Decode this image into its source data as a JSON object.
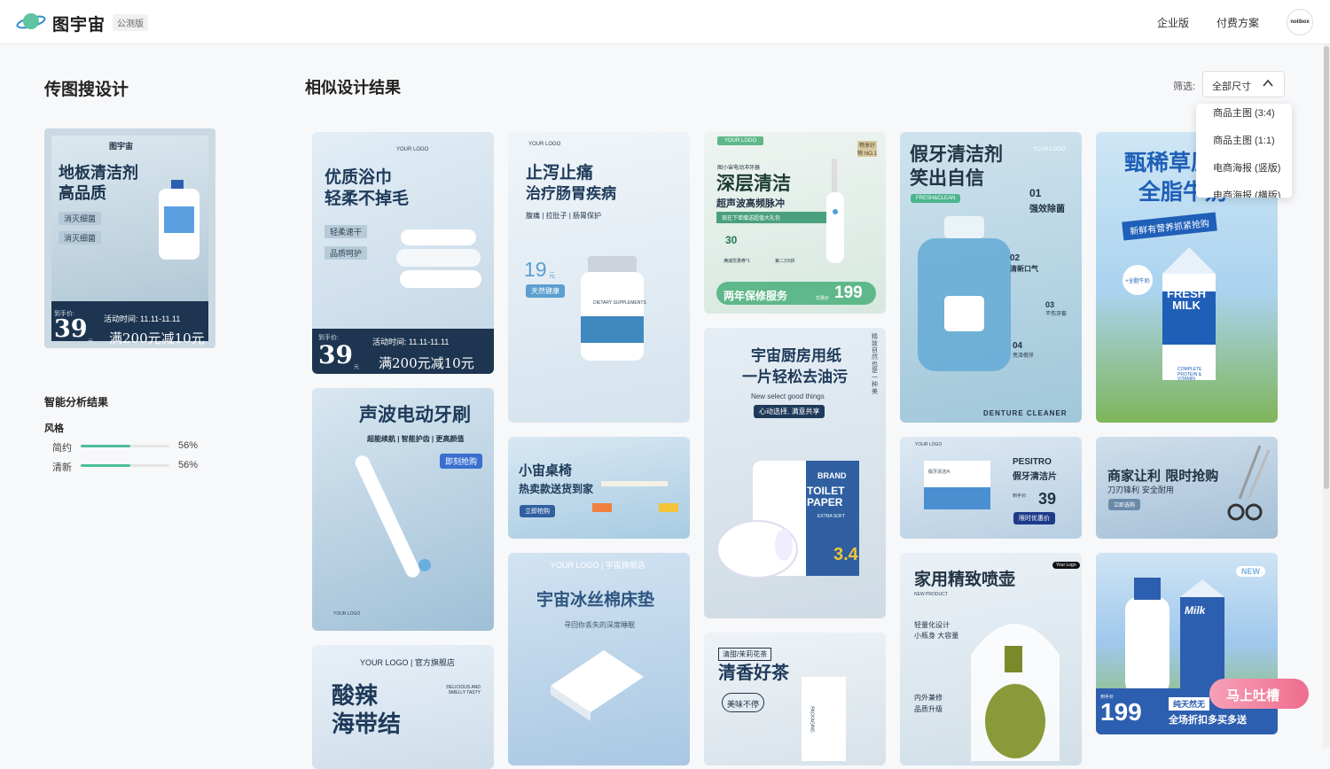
{
  "nav": {
    "brand": "图宇宙",
    "beta_badge": "公测版",
    "enterprise": "企业版",
    "pricing": "付费方案",
    "avatar": "nolibox"
  },
  "left": {
    "title": "传图搜设计",
    "upload": {
      "logo": "图宇宙",
      "title_1": "地板清洁剂",
      "title_2": "高品质",
      "tag_1": "消灭细菌",
      "tag_2": "消灭细菌",
      "price_label": "到手价:",
      "price": "39",
      "unit": "元",
      "date": "活动时间: 11.11-11.11",
      "promo": "满200元减10元"
    },
    "analysis_title": "智能分析结果",
    "style_label": "风格",
    "styles": [
      {
        "name": "简约",
        "pct": "56%",
        "value": 0.56
      },
      {
        "name": "清新",
        "pct": "56%",
        "value": 0.56
      }
    ]
  },
  "results": {
    "title": "相似设计结果",
    "filter_label": "筛选:",
    "filter_value": "全部尺寸",
    "options": [
      "商品主图 (3:4)",
      "商品主图 (1:1)",
      "电商海报 (竖版)",
      "电商海报 (横版)"
    ]
  },
  "cards": {
    "bath": {
      "logo": "YOUR LOGO",
      "title_1": "优质浴巾",
      "title_2": "轻柔不掉毛",
      "tag_1": "轻柔速干",
      "tag_2": "品质呵护",
      "price_label": "到手价:",
      "price": "39",
      "unit": "元",
      "date": "活动时间: 11.11-11.11",
      "promo": "满200元减10元"
    },
    "tooth": {
      "title": "声波电动牙刷",
      "sub": "超能续航 | 智能护齿 | 更高颜值",
      "pill": "即刻抢购",
      "logo": "YOUR LOGO"
    },
    "kelp": {
      "logo": "YOUR LOGO | 官方旗舰店",
      "title_1": "酸辣",
      "title_2": "海带结",
      "sub": "DELICIOUS AND SMELLY TASTY"
    },
    "med": {
      "logo": "YOUR LOGO",
      "title_1": "止泻止痛",
      "title_2": "治疗肠胃疾病",
      "sub": "腹痛 | 拉肚子 | 肠胃保护",
      "price": "19",
      "unit": "元",
      "pill": "天然健康",
      "bottle": "DIETARY SUPPLEMENTS"
    },
    "desk": {
      "title_1": "小宙桌椅",
      "title_2": "热卖款送货到家",
      "pill": "立即抢购"
    },
    "mat": {
      "logo": "YOUR LOGO | 宇宙旗舰店",
      "title": "宇宙冰丝棉床垫",
      "sub": "寻回你丢失的深度睡眠"
    },
    "pulse": {
      "logo": "YOUR LOGO",
      "badge": "畅享好物 NO.1",
      "small": "图小宙电动冲牙器",
      "title": "深层清洁",
      "sub": "超声波高频脉冲",
      "bar": "现在下单赠送超值大礼包",
      "num": "30",
      "gift1": "满减优惠券*1",
      "gift2": "第二只5折",
      "service": "两年保修服务",
      "price_label": "优惠价",
      "price": "199"
    },
    "paper": {
      "vert": "精致自然 也是一种美",
      "title_1": "宇宙厨房用纸",
      "title_2": "一片轻松去油污",
      "sub": "New select good things",
      "pill": "心动选择, 满意共享",
      "brand": "BRAND",
      "name": "TOILET PAPER",
      "extra": "EXTRA SOFT",
      "count": "3.4"
    },
    "tea": {
      "tag": "清甜/茉莉花茶",
      "title": "清香好茶",
      "badge": "美味不停",
      "pack": "PACKAGING"
    },
    "denture": {
      "logo": "YOUR LOGO",
      "title_1": "假牙清洁剂",
      "title_2": "笑出自信",
      "pill": "FRESH&CLEAN",
      "f1": "01",
      "f1t": "强效除菌",
      "f2": "02",
      "f2t": "清新口气",
      "f3": "03",
      "f3t": "不伤牙套",
      "f4": "04",
      "f4t": "亮泽假牙",
      "foot": "DENTURE CLEANER"
    },
    "tablet": {
      "logo": "YOUR LOGO",
      "brand": "PESITRO",
      "name": "假牙清洁片",
      "price_label": "到手价:",
      "price": "39",
      "pill": "限时优惠价",
      "box": "假牙清洁片"
    },
    "spray": {
      "logo": "Your Logo",
      "title": "家用精致喷壶",
      "en": "NEW PRODUCT",
      "f1": "轻量化设计",
      "f2": "小瓶身 大容量",
      "f3": "内外兼修",
      "f4": "品质升级"
    },
    "milk": {
      "title_1": "甄稀草原",
      "title_2": "全脂牛奶",
      "ribbon": "新鲜有营养抓紧抢购",
      "badge": "+全脂牛奶",
      "brand": "Brand",
      "name": "FRESH MILK",
      "note": "COMPLETE PROTEIN & VITAMIN"
    },
    "scissors": {
      "title": "商家让利 限时抢购",
      "sub": "刀刃锋利 安全耐用",
      "pill": "立即选购"
    },
    "milk2": {
      "new": "NEW",
      "label": "Milk",
      "price_label": "到手价",
      "price": "199",
      "tag": "纯天然无",
      "promo": "全场折扣多买多送"
    }
  },
  "feedback": "马上吐槽",
  "colors": {
    "accent": "#4ec09b",
    "brand_blue": "#1e3a5a",
    "pill_blue": "#2f7fb0",
    "feedback": "#ef6d8e"
  }
}
